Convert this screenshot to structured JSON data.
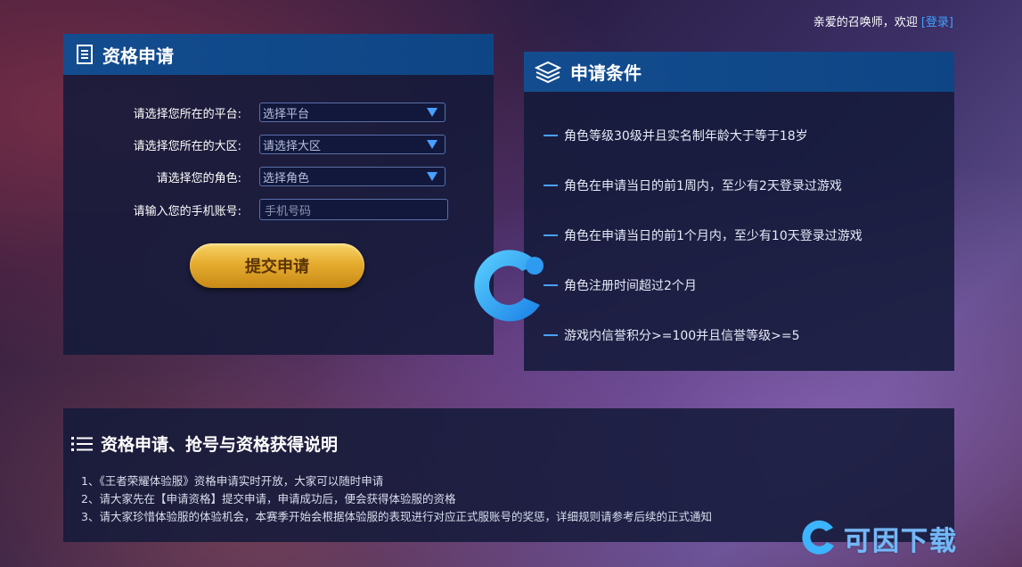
{
  "topbar": {
    "greeting": "亲爱的召唤师，欢迎",
    "login": "[登录]"
  },
  "apply": {
    "title": "资格申请",
    "icon": "document-icon",
    "fields": {
      "platform": {
        "label": "请选择您所在的平台:",
        "value": "选择平台"
      },
      "region": {
        "label": "请选择您所在的大区:",
        "value": "请选择大区"
      },
      "role": {
        "label": "请选择您的角色:",
        "value": "选择角色"
      },
      "phone": {
        "label": "请输入您的手机账号:",
        "placeholder": "手机号码"
      }
    },
    "submit_label": "提交申请"
  },
  "conditions": {
    "title": "申请条件",
    "icon": "layers-icon",
    "items": [
      "角色等级30级并且实名制年龄大于等于18岁",
      "角色在申请当日的前1周内，至少有2天登录过游戏",
      "角色在申请当日的前1个月内，至少有10天登录过游戏",
      "角色注册时间超过2个月",
      "游戏内信誉积分>=100并且信誉等级>=5"
    ]
  },
  "notes": {
    "title": "资格申请、抢号与资格获得说明",
    "icon": "list-icon",
    "lines": [
      "1、《王者荣耀体验服》资格申请实时开放，大家可以随时申请",
      "2、请大家先在【申请资格】提交申请，申请成功后，便会获得体验服的资格",
      "3、请大家珍惜体验服的体验机会，本赛季开始会根据体验服的表现进行对应正式服账号的奖惩，详细规则请参考后续的正式通知"
    ]
  },
  "watermark": {
    "text": "可因下载"
  },
  "colors": {
    "accent": "#4aa0ff",
    "header_blue": "#134d8f",
    "gold": "#e6ac2e"
  }
}
